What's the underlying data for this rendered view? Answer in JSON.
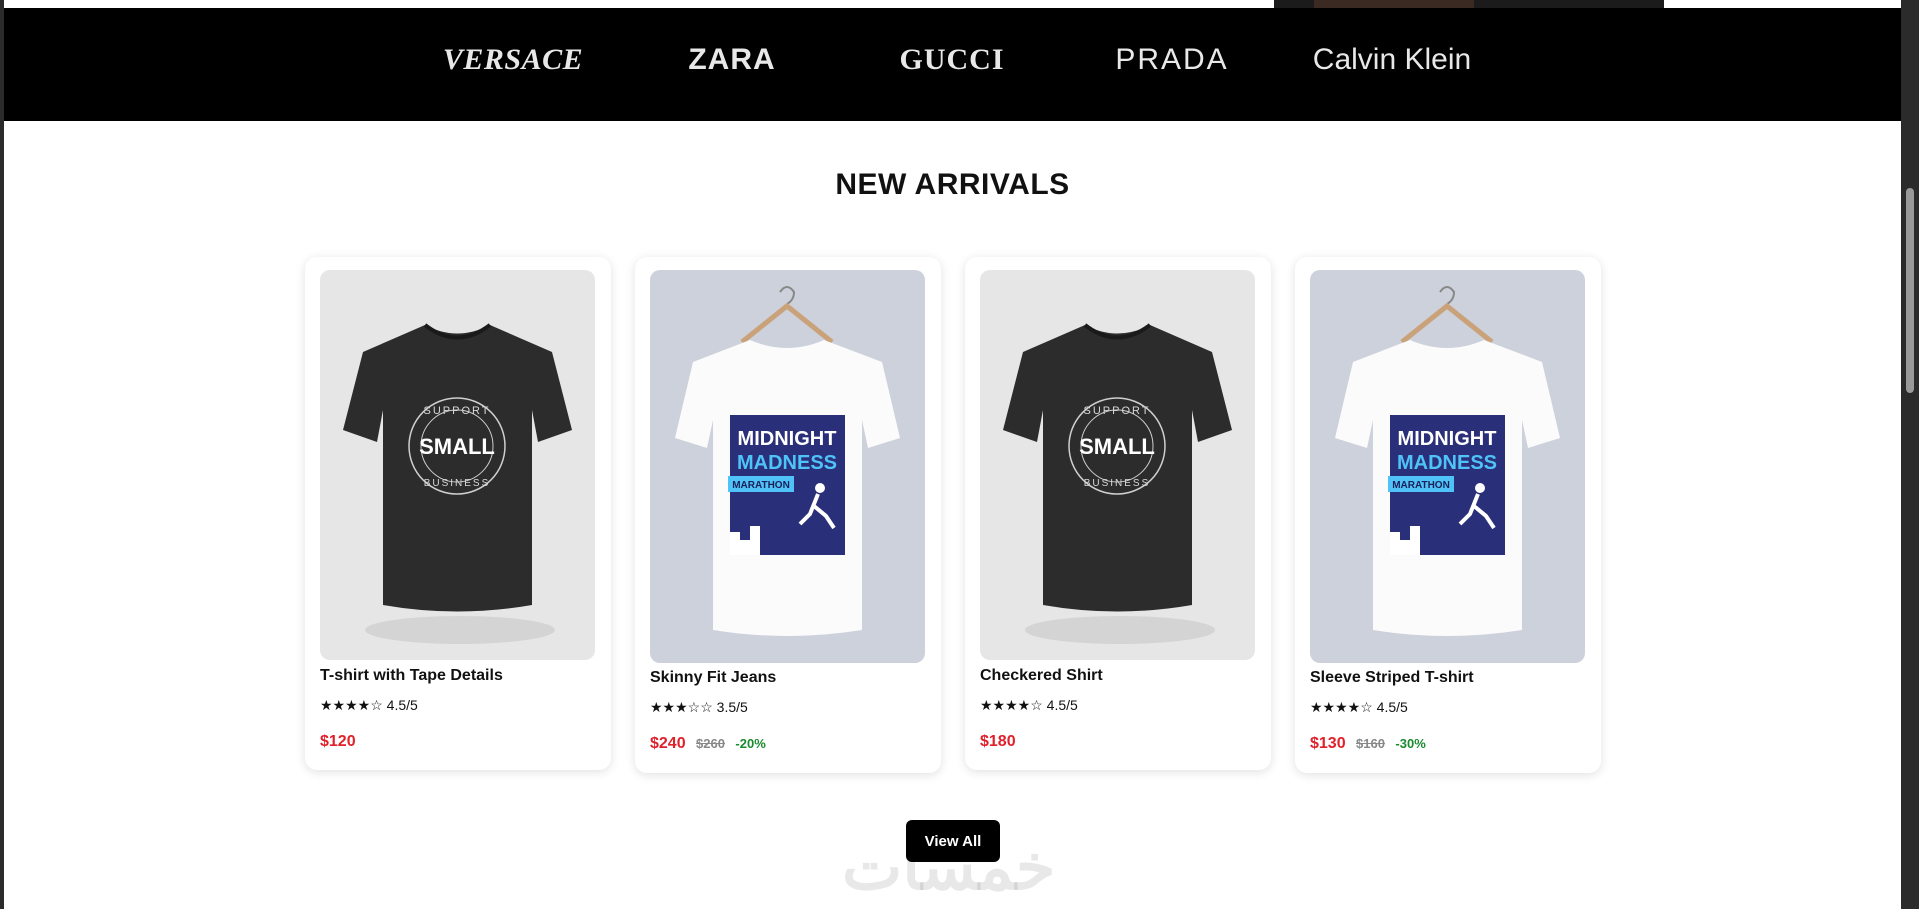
{
  "brands": [
    "VERSACE",
    "ZARA",
    "GUCCI",
    "PRADA",
    "Calvin Klein"
  ],
  "section": {
    "title": "NEW ARRIVALS"
  },
  "products": [
    {
      "name": "T-shirt with Tape Details",
      "stars": "★★★★☆",
      "rating": "4.5/5",
      "price": "$120",
      "old_price": "",
      "discount": "",
      "image": "black-tshirt",
      "print_top": "SUPPORT",
      "print_main": "SMALL",
      "print_bottom": "BUSINESS"
    },
    {
      "name": "Skinny Fit Jeans",
      "stars": "★★★☆☆",
      "rating": "3.5/5",
      "price": "$240",
      "old_price": "$260",
      "discount": "-20%",
      "image": "white-tshirt",
      "print_line1": "MIDNIGHT",
      "print_line2": "MADNESS",
      "print_tag": "MARATHON"
    },
    {
      "name": "Checkered Shirt",
      "stars": "★★★★☆",
      "rating": "4.5/5",
      "price": "$180",
      "old_price": "",
      "discount": "",
      "image": "black-tshirt",
      "print_top": "SUPPORT",
      "print_main": "SMALL",
      "print_bottom": "BUSINESS"
    },
    {
      "name": "Sleeve Striped T-shirt",
      "stars": "★★★★☆",
      "rating": "4.5/5",
      "price": "$130",
      "old_price": "$160",
      "discount": "-30%",
      "image": "white-tshirt",
      "print_line1": "MIDNIGHT",
      "print_line2": "MADNESS",
      "print_tag": "MARATHON"
    }
  ],
  "actions": {
    "view_all": "View All"
  },
  "watermark": "خمسات",
  "colors": {
    "price": "#e0202a",
    "discount": "#1a8a2e",
    "brand_bar": "#000000"
  }
}
